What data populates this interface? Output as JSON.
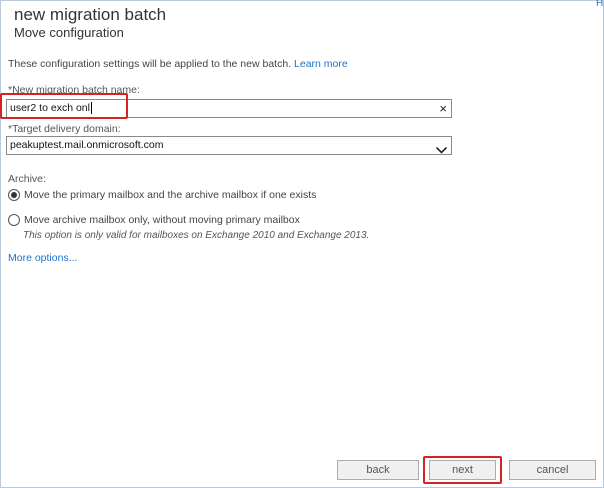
{
  "header": {
    "help_link": "H",
    "title": "new migration batch",
    "subtitle": "Move configuration"
  },
  "intro": {
    "text": "These configuration settings will be applied to the new batch.",
    "learn_more": "Learn more"
  },
  "batch_name": {
    "label": "*New migration batch name:",
    "value": "user2 to exch onl",
    "clear_glyph": "×"
  },
  "delivery_domain": {
    "label": "*Target delivery domain:",
    "value": "peakuptest.mail.onmicrosoft.com"
  },
  "archive": {
    "label": "Archive:",
    "options": [
      {
        "label": "Move the primary mailbox and the archive mailbox if one exists",
        "checked": true
      },
      {
        "label": "Move archive mailbox only, without moving primary mailbox",
        "checked": false
      }
    ],
    "note": "This option is only valid for mailboxes on Exchange 2010 and Exchange 2013."
  },
  "more_options": "More options...",
  "buttons": {
    "back": "back",
    "next": "next",
    "cancel": "cancel"
  },
  "colors": {
    "accent": "#1e73c8",
    "highlight": "#d62222"
  }
}
